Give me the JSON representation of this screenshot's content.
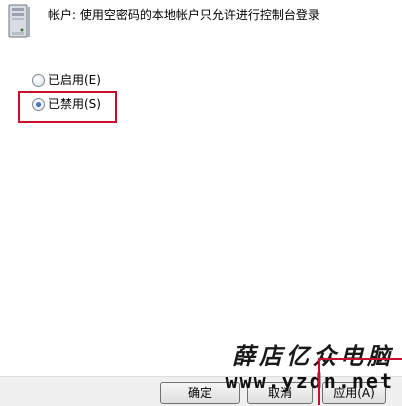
{
  "policy": {
    "icon": "server-computer-icon",
    "title": "帐户: 使用空密码的本地帐户只允许进行控制台登录"
  },
  "options": {
    "enabled_label": "已启用(E)",
    "disabled_label": "已禁用(S)",
    "selected": "disabled"
  },
  "buttons": {
    "ok_label": "确定",
    "cancel_label": "取消",
    "apply_label": "应用(A)"
  },
  "watermark": {
    "brand_text": "薛店亿众电脑",
    "url_text": "www.yzdn.net"
  },
  "colors": {
    "highlight": "#c8102e",
    "radio_dot": "#1d4d8f"
  }
}
